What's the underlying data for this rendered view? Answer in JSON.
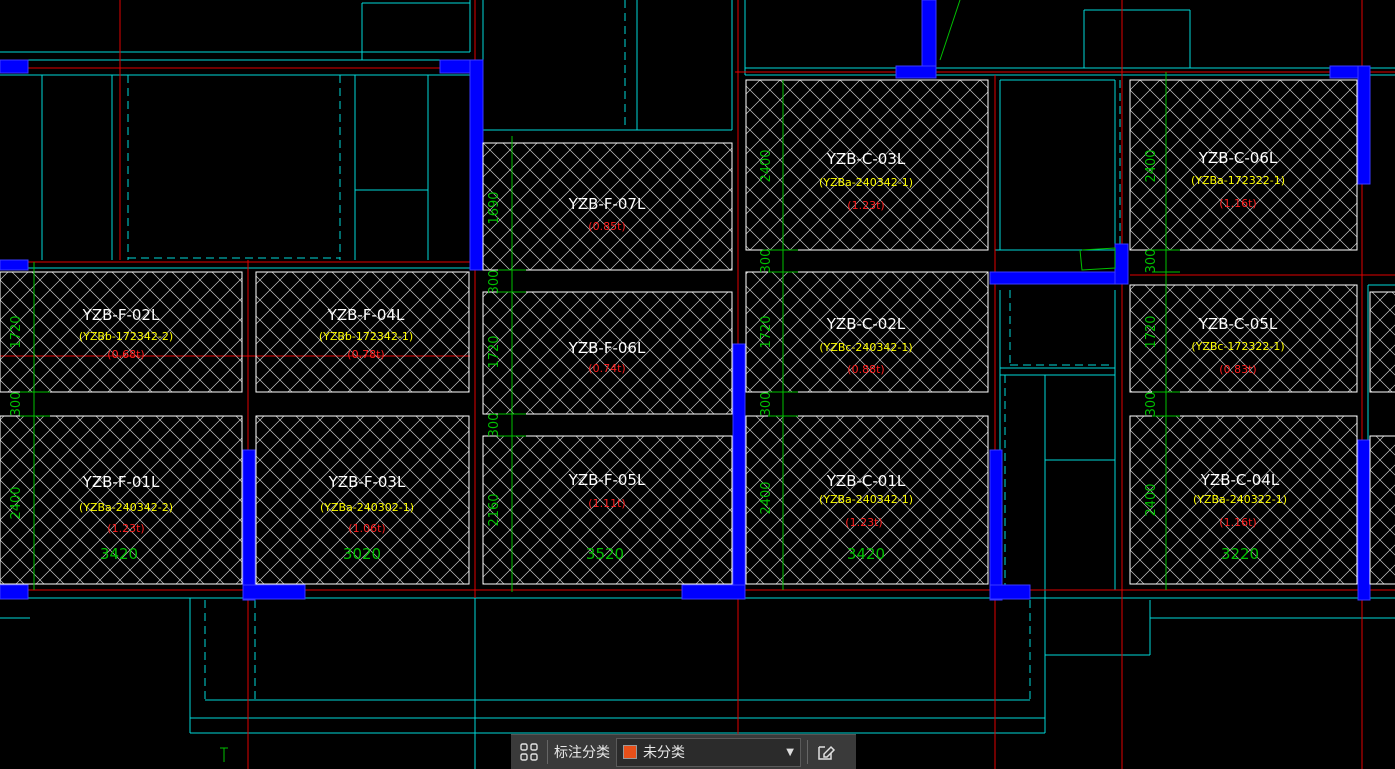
{
  "slabs": [
    {
      "name": "YZB-F-02L",
      "spec": "(YZBb-172342-2)",
      "load": "(0.68t)"
    },
    {
      "name": "YZB-F-04L",
      "spec": "(YZBb-172342-1)",
      "load": "(0.78t)"
    },
    {
      "name": "YZB-F-07L",
      "spec": "",
      "load": "(0.85t)"
    },
    {
      "name": "YZB-F-06L",
      "spec": "",
      "load": "(0.74t)"
    },
    {
      "name": "YZB-F-01L",
      "spec": "(YZBa-240342-2)",
      "load": "(1.23t)",
      "width": "3420"
    },
    {
      "name": "YZB-F-03L",
      "spec": "(YZBa-240302-1)",
      "load": "(1.06t)",
      "width": "3020"
    },
    {
      "name": "YZB-F-05L",
      "spec": "",
      "load": "(1.11t)",
      "width": "3520"
    },
    {
      "name": "YZB-C-03L",
      "spec": "(YZBa-240342-1)",
      "load": "(1.23t)"
    },
    {
      "name": "YZB-C-02L",
      "spec": "(YZBc-240342-1)",
      "load": "(0.88t)"
    },
    {
      "name": "YZB-C-01L",
      "spec": "(YZBa-240342-1)",
      "load": "(1.23t)",
      "width": "3420"
    },
    {
      "name": "YZB-C-06L",
      "spec": "(YZBa-172322-1)",
      "load": "(1.16t)"
    },
    {
      "name": "YZB-C-05L",
      "spec": "(YZBc-172322-1)",
      "load": "(0.83t)"
    },
    {
      "name": "YZB-C-04L",
      "spec": "(YZBa-240322-1)",
      "load": "(1.16t)",
      "width": "3220"
    }
  ],
  "dimensions": [
    "1720",
    "300",
    "2400",
    "1690",
    "300",
    "1720",
    "300",
    "2160",
    "2400",
    "300",
    "1720",
    "300",
    "2400",
    "2400",
    "300",
    "1720",
    "300",
    "2400"
  ],
  "toolbar": {
    "grid_icon": "grid-four-squares-icon",
    "category_label": "标注分类",
    "category_value": "未分类",
    "category_color": "#e8501a",
    "edit_icon": "edit-pencil-icon"
  },
  "colors": {
    "background": "#000000",
    "wall": "#0000ff",
    "axis": "#ff0000",
    "outline": "#00e5e5",
    "slab_border": "#ffffff",
    "dimension": "#00c000"
  }
}
